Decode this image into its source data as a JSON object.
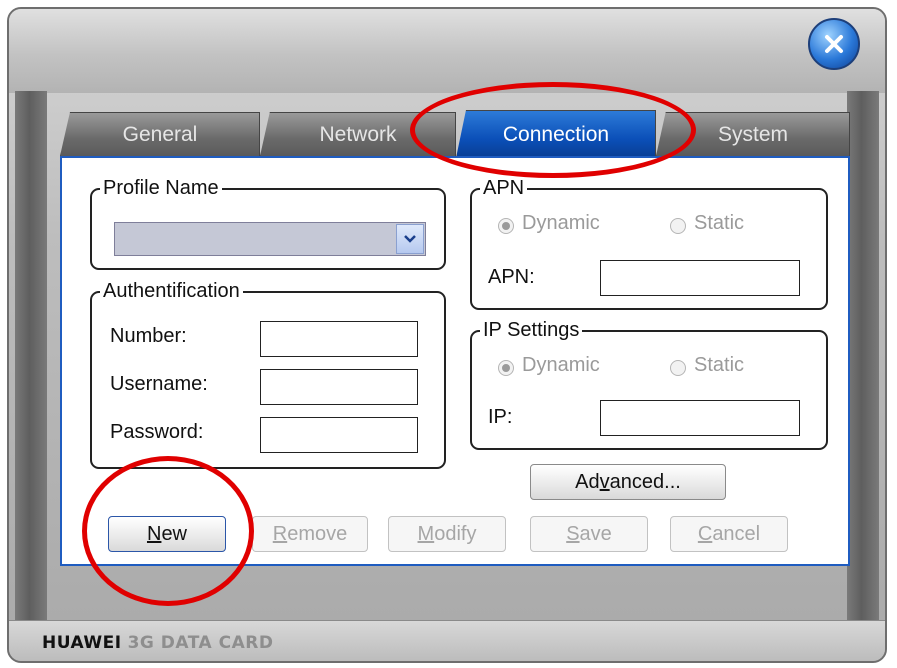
{
  "window": {
    "brand_main": "HUAWEI",
    "brand_sub": "3G DATA CARD"
  },
  "tabs": [
    {
      "label": "General"
    },
    {
      "label": "Network"
    },
    {
      "label": "Connection",
      "active": true
    },
    {
      "label": "System"
    }
  ],
  "profile": {
    "legend": "Profile Name",
    "selected_value": ""
  },
  "auth": {
    "legend": "Authentification",
    "number_label": "Number:",
    "username_label": "Username:",
    "password_label": "Password:",
    "number_value": "",
    "username_value": "",
    "password_value": ""
  },
  "apn": {
    "legend": "APN",
    "dynamic_label": "Dynamic",
    "static_label": "Static",
    "selected": "Dynamic",
    "apn_label": "APN:",
    "apn_value": ""
  },
  "ip": {
    "legend": "IP Settings",
    "dynamic_label": "Dynamic",
    "static_label": "Static",
    "selected": "Dynamic",
    "ip_label": "IP:",
    "ip_value": ""
  },
  "buttons": {
    "advanced": {
      "pre": "Ad",
      "ul": "v",
      "post": "anced..."
    },
    "new": {
      "pre": "",
      "ul": "N",
      "post": "ew"
    },
    "remove": {
      "pre": "",
      "ul": "R",
      "post": "emove"
    },
    "modify": {
      "pre": "",
      "ul": "M",
      "post": "odify"
    },
    "save": {
      "pre": "",
      "ul": "S",
      "post": "ave"
    },
    "cancel": {
      "pre": "",
      "ul": "C",
      "post": "ancel"
    }
  },
  "colors": {
    "accent": "#0b4fb8",
    "annotation": "#e00000",
    "close_button": "#2a78d8"
  },
  "icons": {
    "close": "close-x-icon",
    "dropdown": "chevron-down-icon"
  }
}
